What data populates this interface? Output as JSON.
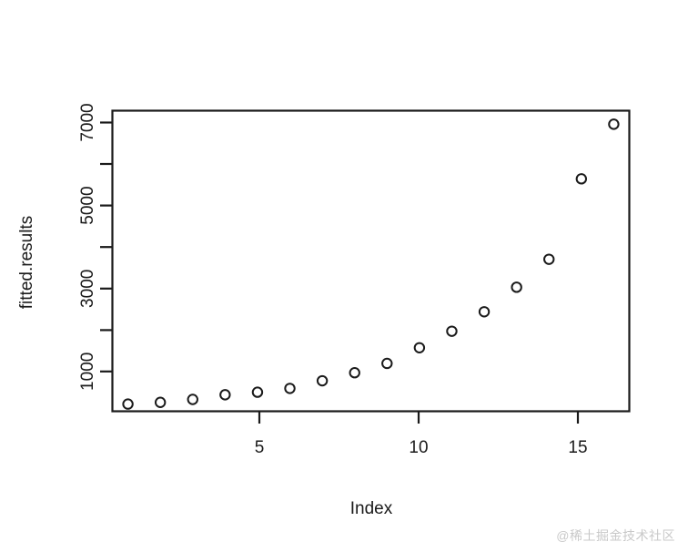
{
  "chart_data": {
    "type": "scatter",
    "title": "",
    "subtitle": "",
    "xlabel": "Index",
    "ylabel": "fitted.results",
    "x": [
      1,
      2,
      3,
      4,
      5,
      6,
      7,
      8,
      9,
      10,
      11,
      12,
      13,
      14,
      15,
      16
    ],
    "values": [
      340,
      380,
      450,
      560,
      620,
      710,
      890,
      1080,
      1300,
      1670,
      2060,
      2520,
      3100,
      3760,
      5660,
      6950
    ],
    "series": [
      {
        "name": "fitted.results",
        "values": [
          340,
          380,
          450,
          560,
          620,
          710,
          890,
          1080,
          1300,
          1670,
          2060,
          2520,
          3100,
          3760,
          5660,
          6950
        ]
      }
    ],
    "xlim": [
      0.52,
      16.48
    ],
    "ylim": [
      170,
      7270
    ],
    "xticks": [
      5,
      10,
      15
    ],
    "xtick_labels": [
      "5",
      "10",
      "15"
    ],
    "yticks": [
      1000,
      2000,
      3000,
      4000,
      5000,
      6000,
      7000
    ],
    "ytick_labels": [
      "1000",
      "",
      "3000",
      "",
      "5000",
      "",
      "7000"
    ],
    "grid": false,
    "legend": null,
    "marker": "open-circle",
    "marker_color": "#1a1a1a",
    "box_color": "#1a1a1a",
    "background": "#ffffff"
  },
  "labels": {
    "x_axis_title": "Index",
    "y_axis_title": "fitted.results",
    "x_tick_1": "5",
    "x_tick_2": "10",
    "x_tick_3": "15",
    "y_tick_1": "1000",
    "y_tick_2": "3000",
    "y_tick_3": "5000",
    "y_tick_4": "7000"
  },
  "watermark": {
    "text": "@稀土掘金技术社区",
    "color": "#c9c9c9"
  }
}
